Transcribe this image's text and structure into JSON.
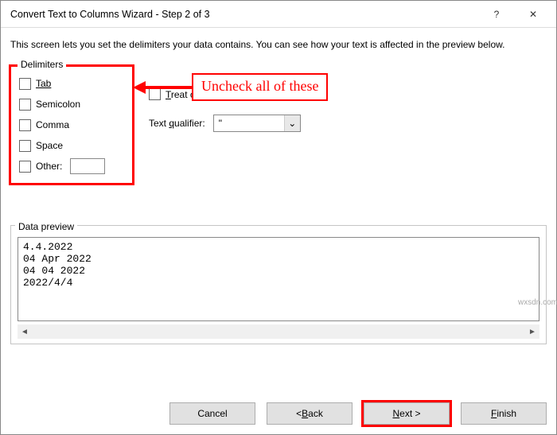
{
  "titlebar": {
    "title": "Convert Text to Columns Wizard - Step 2 of 3",
    "help_icon": "?",
    "close_icon": "✕"
  },
  "instruction": "This screen lets you set the delimiters your data contains.  You can see how your text is affected in the preview below.",
  "delimiters": {
    "legend": "Delimiters",
    "tab": "Tab",
    "semicolon": "Semicolon",
    "comma": "Comma",
    "space": "Space",
    "other": "Other:",
    "other_value": ""
  },
  "treat": {
    "label": "Treat consecutive delimiters as one"
  },
  "text_qualifier": {
    "label": "Text qualifier:",
    "value": "\""
  },
  "annotation": {
    "text": "Uncheck all of these"
  },
  "preview": {
    "legend": "Data preview",
    "lines": "4.4.2022\n04 Apr 2022\n04 04 2022\n2022/4/4"
  },
  "buttons": {
    "cancel": "Cancel",
    "back": "< Back",
    "next": "Next >",
    "finish": "Finish"
  },
  "watermark": "wxsdn.com"
}
